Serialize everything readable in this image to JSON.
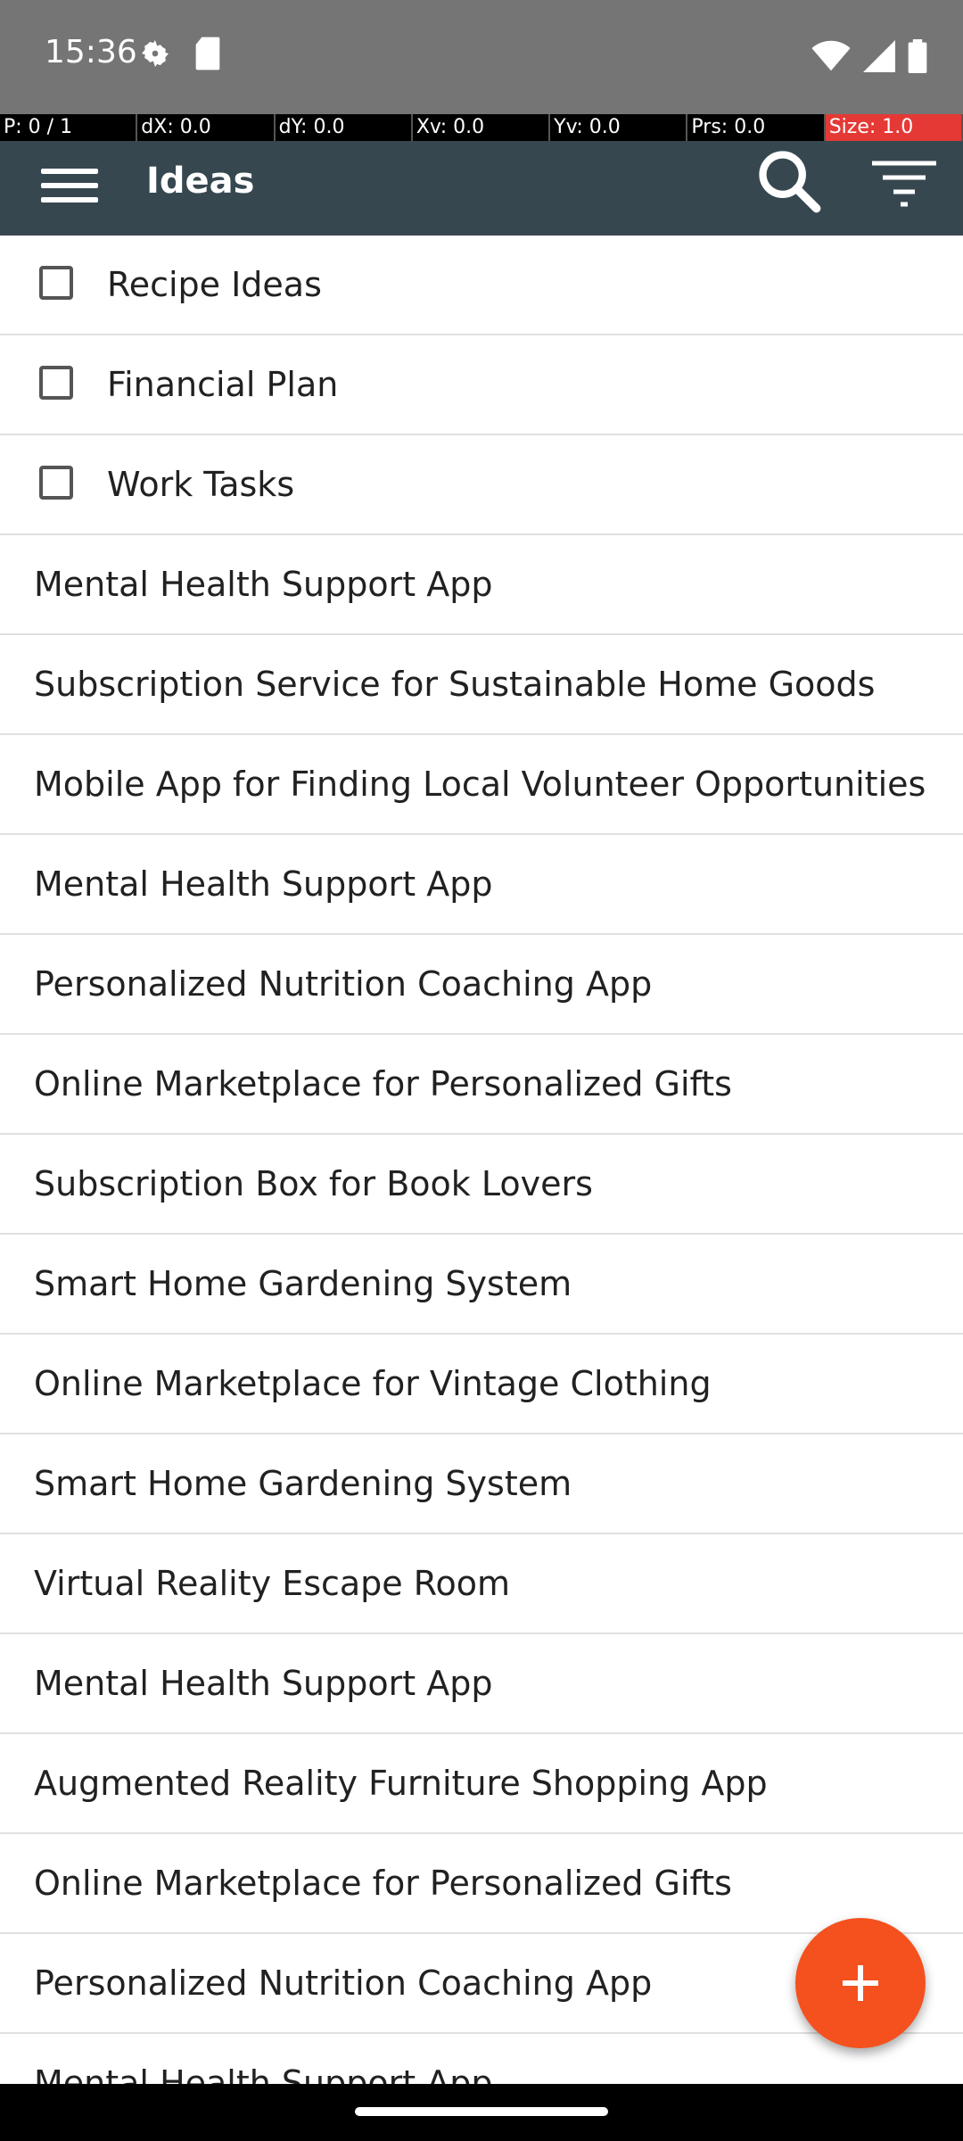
{
  "status_bar": {
    "time": "15:36",
    "icons": [
      "settings-icon",
      "sd-card-icon",
      "wifi-icon",
      "signal-icon",
      "battery-icon"
    ]
  },
  "pointer_bar": {
    "p": "P: 0 / 1",
    "dx": "dX: 0.0",
    "dy": "dY: 0.0",
    "xv": "Xv: 0.0",
    "yv": "Yv: 0.0",
    "prs": "Prs: 0.0",
    "size": "Size: 1.0"
  },
  "app_bar": {
    "title": "Ideas",
    "icons": [
      "menu-icon",
      "search-icon",
      "filter-icon"
    ]
  },
  "todo_items": [
    {
      "label": "Recipe Ideas",
      "checked": false
    },
    {
      "label": "Financial Plan",
      "checked": false
    },
    {
      "label": "Work Tasks",
      "checked": false
    }
  ],
  "ideas": [
    "Mental Health Support App",
    "Subscription Service for Sustainable Home Goods",
    "Mobile App for Finding Local Volunteer Opportunities",
    "Mental Health Support App",
    "Personalized Nutrition Coaching App",
    "Online Marketplace for Personalized Gifts",
    "Subscription Box for Book Lovers",
    "Smart Home Gardening System",
    "Online Marketplace for Vintage Clothing",
    "Smart Home Gardening System",
    "Virtual Reality Escape Room",
    "Mental Health Support App",
    "Augmented Reality Furniture Shopping App",
    "Online Marketplace for Personalized Gifts",
    "Personalized Nutrition Coaching App",
    "Mental Health Support App"
  ],
  "fab": {
    "icon": "plus-icon"
  },
  "colors": {
    "app_bar": "#37474f",
    "status_bar": "#757575",
    "fab": "#f4511e",
    "pointer_size_cell": "#e53935"
  }
}
